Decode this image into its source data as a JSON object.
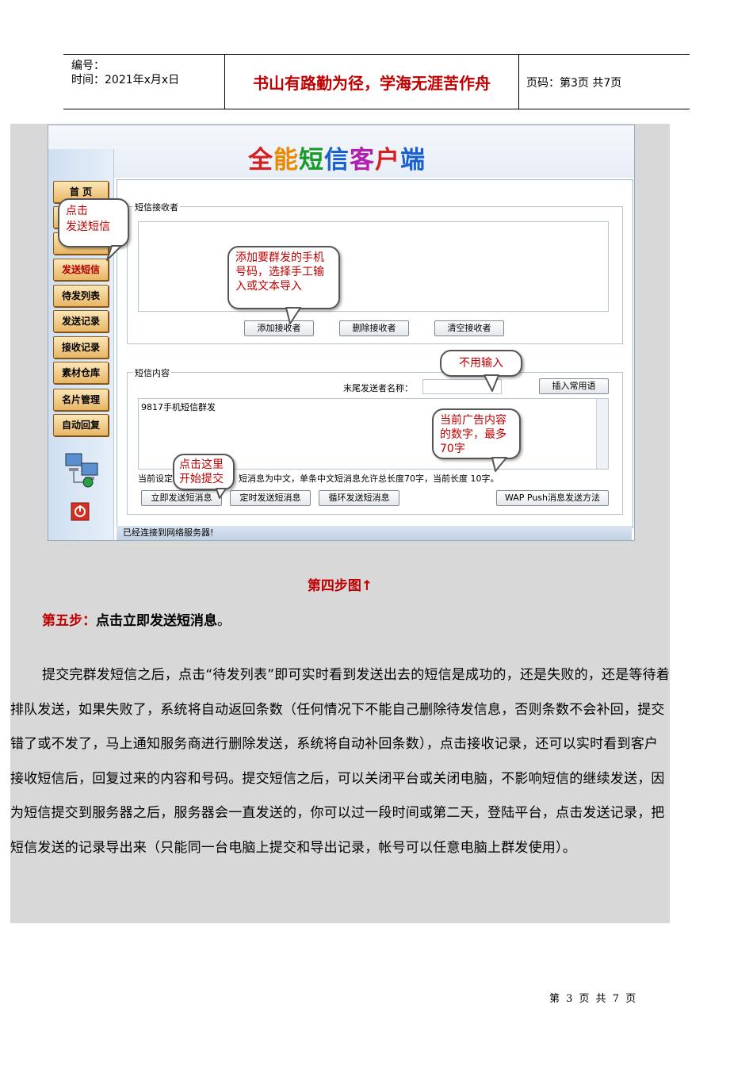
{
  "header": {
    "number_label": "编号：",
    "time_label": "时间：2021年x月x日",
    "motto": "书山有路勤为径，学海无涯苦作舟",
    "page_info": "页码：第3页  共7页"
  },
  "app": {
    "logo": [
      "全",
      "能",
      "短",
      "信",
      "客",
      "户",
      "端"
    ],
    "logo_colors": [
      "#d61f1f",
      "#e98a00",
      "#1a9a2a",
      "#1a5fd0",
      "#b01fb0",
      "#d61f1f",
      "#1a5fd0"
    ],
    "nav": [
      "首  页",
      "",
      "",
      "发送短信",
      "待发列表",
      "发送记录",
      "接收记录",
      "素材仓库",
      "名片管理",
      "自动回复"
    ],
    "recipients_legend": "短信接收者",
    "add_recipient": "添加接收者",
    "delete_recipient": "删除接收者",
    "clear_recipients": "清空接收者",
    "content_legend": "短信内容",
    "sender_name_label": "末尾发送者名称：",
    "insert_phrase": "插入常用语",
    "message_text": "9817手机短信群发",
    "current_setting": "当前设定",
    "length_info": "短消息为中文，单条中文短消息允许总长度70字，当前长度 10字。",
    "send_now": "立即发送短消息",
    "send_timed": "定时发送短消息",
    "send_loop": "循环发送短消息",
    "wap_push": "WAP Push消息发送方法",
    "status": "已经连接到网络服务器!",
    "callouts": {
      "click_send": [
        "点击",
        "发送短信"
      ],
      "add_numbers": [
        "添加要群发的手机",
        "号码，选择手工输",
        "入或文本导入"
      ],
      "no_input": "不用输入",
      "ad_content": [
        "当前广告内容",
        "的数字，最多",
        "70字"
      ],
      "click_submit": [
        "点击这里",
        "开始提交"
      ]
    }
  },
  "caption": "第四步图↑",
  "step": {
    "label": "第五步：",
    "text": "点击立即发送短消息",
    "end": "。"
  },
  "paragraph": "提交完群发短信之后，点击“待发列表”即可实时看到发送出去的短信是成功的，还是失败的，还是等待着排队发送，如果失败了，系统将自动返回条数（任何情况下不能自己删除待发信息，否则条数不会补回，提交错了或不发了，马上通知服务商进行删除发送，系统将自动补回条数），点击接收记录，还可以实时看到客户接收短信后，回复过来的内容和号码。提交短信之后，可以关闭平台或关闭电脑，不影响短信的继续发送，因为短信提交到服务器之后，服务器会一直发送的，你可以过一段时间或第二天，登陆平台，点击发送记录，把短信发送的记录导出来（只能同一台电脑上提交和导出记录，帐号可以任意电脑上群发使用）。",
  "footer": "第 3 页 共 7 页"
}
